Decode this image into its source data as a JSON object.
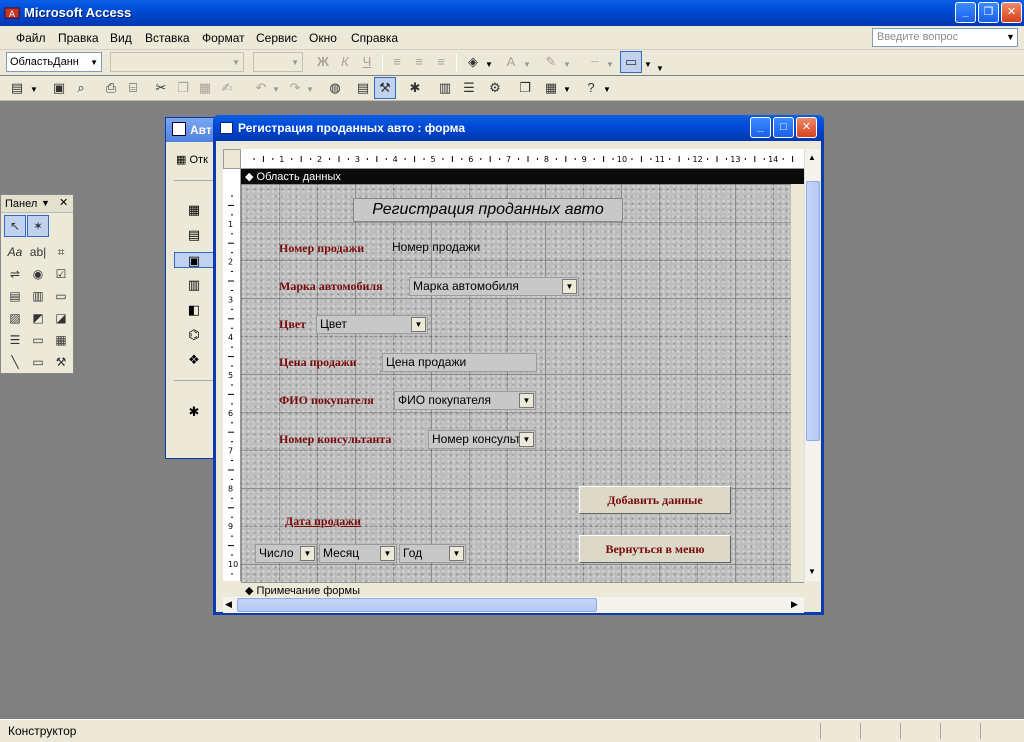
{
  "app": {
    "title": "Microsoft Access"
  },
  "menu": {
    "items": [
      "Файл",
      "Правка",
      "Вид",
      "Вставка",
      "Формат",
      "Сервис",
      "Окно",
      "Справка"
    ],
    "help_placeholder": "Введите вопрос"
  },
  "toolbar": {
    "object_combo": "ОбластьДанн",
    "font_bold": "Ж",
    "font_italic": "К",
    "font_underline": "Ч"
  },
  "db_window": {
    "title": "Авт",
    "open_label": "Отк"
  },
  "toolbox": {
    "title": "Панел"
  },
  "form_window": {
    "title": "Регистрация проданных авто : форма",
    "section_detail": "Область данных",
    "section_notes": "Примечание формы",
    "heading": "Регистрация проданных авто",
    "fields": {
      "sale_number": {
        "label": "Номер продажи",
        "value": "Номер продажи"
      },
      "car_brand": {
        "label": "Марка автомобиля",
        "value": "Марка автомобиля"
      },
      "color": {
        "label": "Цвет",
        "value": "Цвет"
      },
      "price": {
        "label": "Цена продажи",
        "value": "Цена продажи"
      },
      "buyer": {
        "label": "ФИО покупателя",
        "value": "ФИО покупателя"
      },
      "consultant": {
        "label": "Номер консультанта",
        "value": "Номер консульт"
      },
      "sale_date": {
        "label": "Дата продажи",
        "day": "Число",
        "month": "Месяц",
        "year": "Год"
      }
    },
    "buttons": {
      "add": "Добавить данные",
      "back": "Вернуться в меню"
    },
    "ruler_top": [
      "1",
      "2",
      "3",
      "4",
      "5",
      "6",
      "7",
      "8",
      "9",
      "10",
      "11",
      "12",
      "13",
      "14"
    ],
    "ruler_left": [
      "1",
      "2",
      "3",
      "4",
      "5",
      "6",
      "7",
      "8",
      "9",
      "10"
    ]
  },
  "status": {
    "text": "Конструктор"
  },
  "colors": {
    "label": "#7a0a0a",
    "titlebar": "#0049d4"
  }
}
